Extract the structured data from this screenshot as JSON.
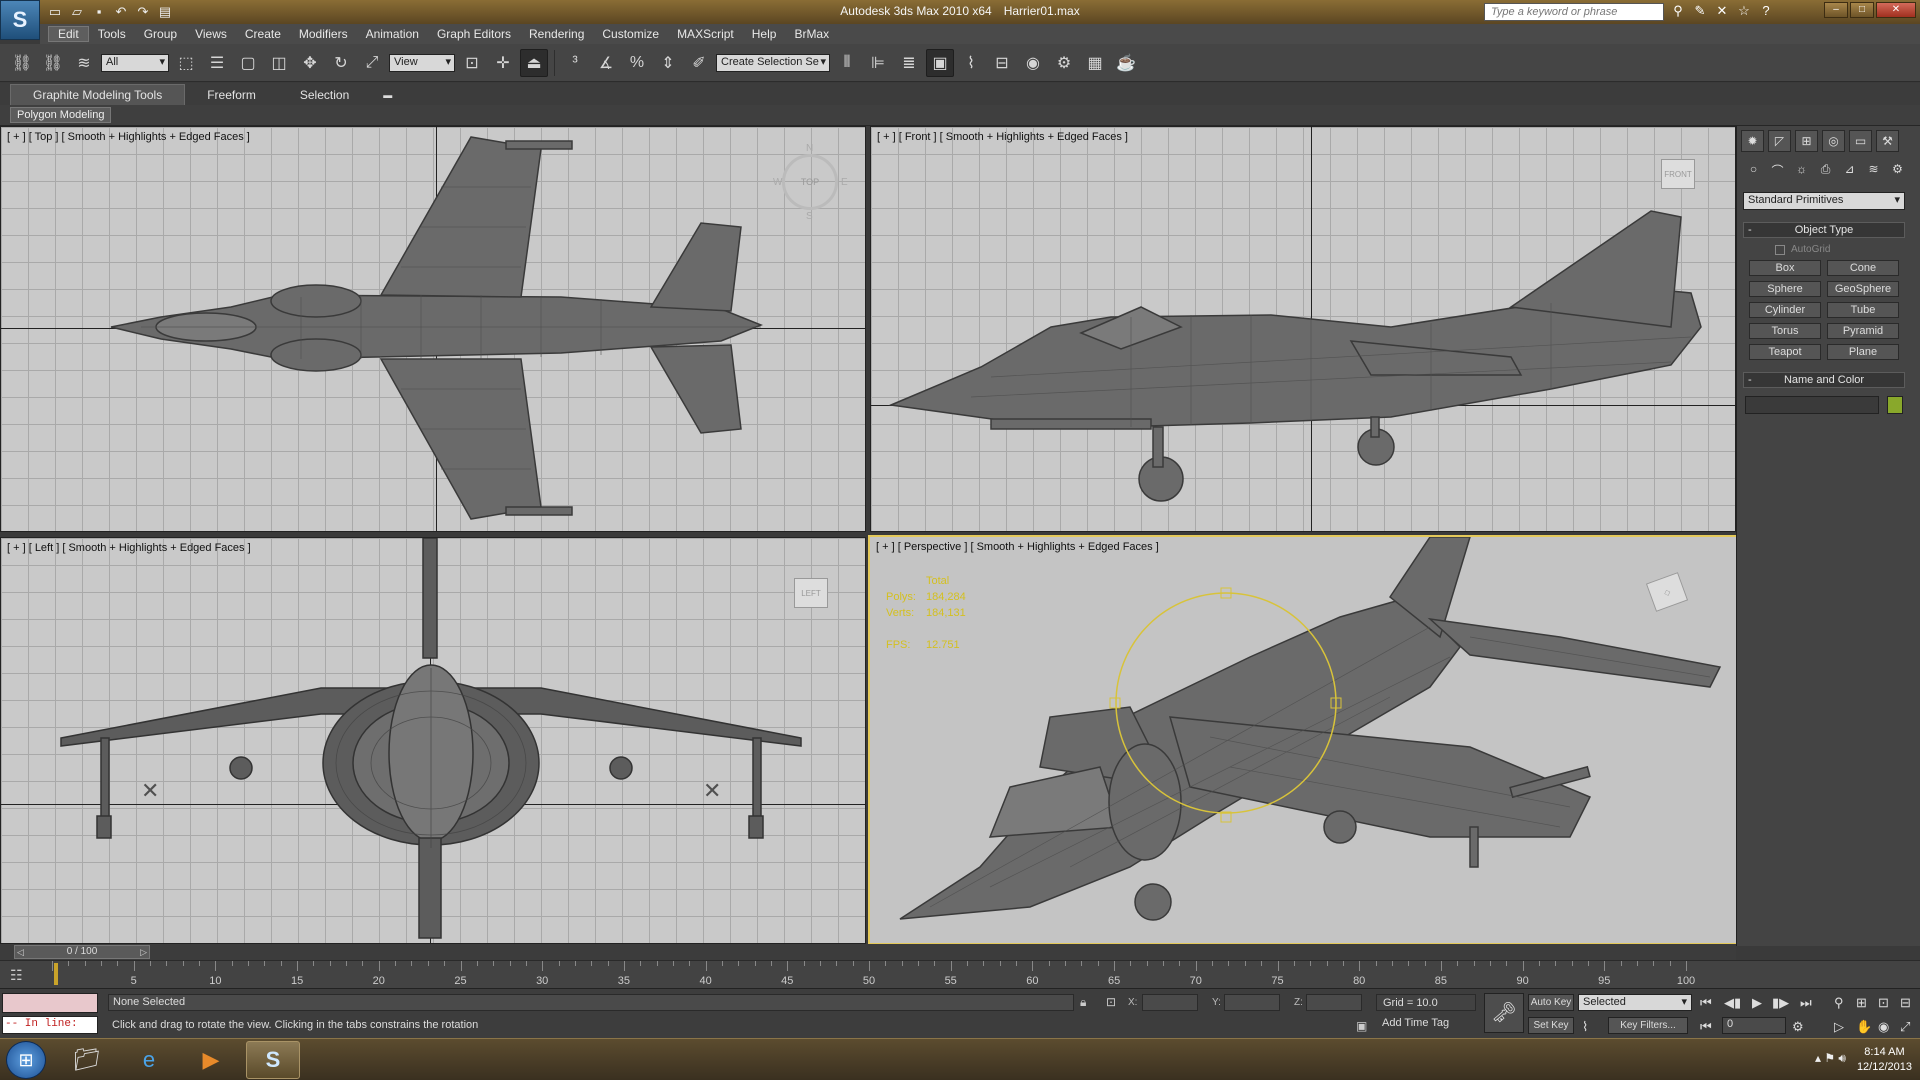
{
  "app": {
    "title": "Autodesk 3ds Max  2010 x64",
    "file": "Harrier01.max",
    "search_placeholder": "Type a keyword or phrase"
  },
  "menu": [
    "Edit",
    "Tools",
    "Group",
    "Views",
    "Create",
    "Modifiers",
    "Animation",
    "Graph Editors",
    "Rendering",
    "Customize",
    "MAXScript",
    "Help",
    "BrMax"
  ],
  "toolbar": {
    "selection_filter": "All",
    "reference_coord": "View",
    "named_selection": "Create Selection Se"
  },
  "ribbon": {
    "tabs": [
      "Graphite Modeling Tools",
      "Freeform",
      "Selection"
    ],
    "panel": "Polygon Modeling"
  },
  "viewports": {
    "top": {
      "label": "[ + ] [ Top ] [ Smooth + Highlights + Edged Faces ]",
      "compass": {
        "n": "N",
        "s": "S",
        "w": "W",
        "e": "E",
        "cube": "TOP"
      }
    },
    "front": {
      "label": "[ + ] [ Front ] [ Smooth + Highlights + Edged Faces ]",
      "cube": "FRONT"
    },
    "left": {
      "label": "[ + ] [ Left ] [ Smooth + Highlights + Edged Faces ]",
      "cube": "LEFT"
    },
    "perspective": {
      "label": "[ + ] [ Perspective ] [ Smooth + Highlights + Edged Faces ]",
      "stats": {
        "heading": "Total",
        "polys_label": "Polys:",
        "polys": "184,284",
        "verts_label": "Verts:",
        "verts": "184,131",
        "fps_label": "FPS:",
        "fps": "12.751"
      }
    }
  },
  "command_panel": {
    "category": "Standard Primitives",
    "object_type": "Object Type",
    "autogrid": "AutoGrid",
    "buttons": [
      "Box",
      "Cone",
      "Sphere",
      "GeoSphere",
      "Cylinder",
      "Tube",
      "Torus",
      "Pyramid",
      "Teapot",
      "Plane"
    ],
    "name_and_color": "Name and Color",
    "object_color": "#89a82b"
  },
  "time": {
    "slider": "0 / 100",
    "ticks": [
      "5",
      "10",
      "15",
      "20",
      "25",
      "30",
      "35",
      "40",
      "45",
      "50",
      "55",
      "60",
      "65",
      "70",
      "75",
      "80",
      "85",
      "90",
      "95",
      "100"
    ]
  },
  "status": {
    "selection": "None Selected",
    "prompt": "Click and drag to rotate the view.  Clicking in the tabs constrains the rotation",
    "inline_label": "-- In line:",
    "x_label": "X:",
    "y_label": "Y:",
    "z_label": "Z:",
    "grid": "Grid = 10.0",
    "add_time_tag": "Add Time Tag",
    "auto_key": "Auto Key",
    "set_key": "Set Key",
    "selected": "Selected",
    "key_filters": "Key Filters...",
    "frame": "0"
  },
  "taskbar": {
    "time": "8:14 AM",
    "date": "12/12/2013"
  }
}
